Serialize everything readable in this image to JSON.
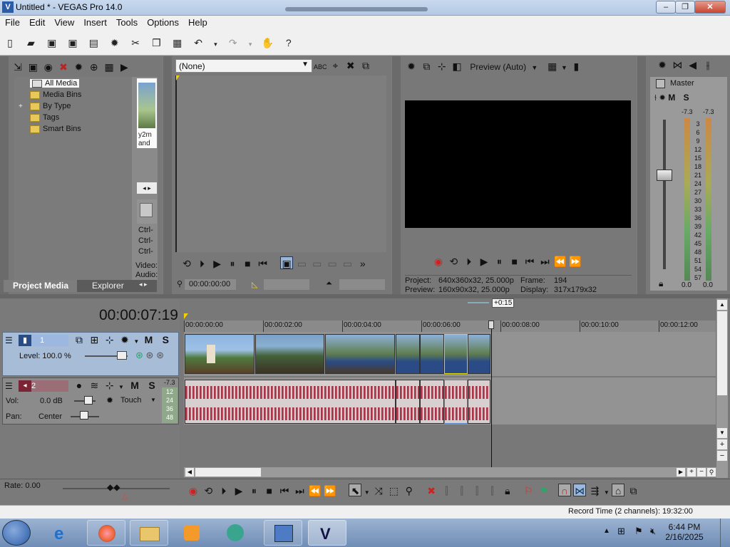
{
  "window": {
    "title": "Untitled * - VEGAS Pro 14.0",
    "minimize": "–",
    "maximize": "❐",
    "close": "✕"
  },
  "menu": [
    "File",
    "Edit",
    "View",
    "Insert",
    "Tools",
    "Options",
    "Help"
  ],
  "project_media": {
    "tree": [
      "All Media",
      "Media Bins",
      "By Type",
      "Tags",
      "Smart Bins"
    ],
    "expand_glyph": "+",
    "thumb_caption": "y2m and",
    "side_labels": [
      "Ctrl-",
      "Ctrl-",
      "Ctrl-"
    ],
    "media_info": [
      "Video:",
      "Audio:"
    ],
    "tabs": [
      "Project Media",
      "Explorer"
    ]
  },
  "trimmer": {
    "selection": "(None)",
    "timecode": "00:00:00:00"
  },
  "preview": {
    "mode": "Preview (Auto)",
    "project_label": "Project:",
    "project_value": "640x360x32, 25.000p",
    "preview_label": "Preview:",
    "preview_value": "160x90x32, 25.000p",
    "frame_label": "Frame:",
    "frame_value": "194",
    "display_label": "Display:",
    "display_value": "317x179x32"
  },
  "master": {
    "title": "Master",
    "m": "M",
    "s": "S",
    "peak_left": "-7.3",
    "peak_right": "-7.3",
    "scale": [
      "3",
      "6",
      "9",
      "12",
      "15",
      "18",
      "21",
      "24",
      "27",
      "30",
      "33",
      "36",
      "39",
      "42",
      "45",
      "48",
      "51",
      "54",
      "57"
    ],
    "bottom_left": "0.0",
    "bottom_right": "0.0"
  },
  "timeline": {
    "current_time": "00:00:07:19",
    "marker_offset": "+0:15",
    "ruler": [
      "00:00:00:00",
      "00:00:02:00",
      "00:00:04:00",
      "00:00:06:00",
      "00:00:08:00",
      "00:00:10:00",
      "00:00:12:00"
    ],
    "rate": "Rate: 0.00"
  },
  "video_track": {
    "number": "1",
    "level": "Level: 100.0 %",
    "m": "M",
    "s": "S"
  },
  "audio_track": {
    "number": "2",
    "m": "M",
    "s": "S",
    "vol_label": "Vol:",
    "vol_value": "0.0 dB",
    "pan_label": "Pan:",
    "pan_value": "Center",
    "mode": "Touch",
    "peak": "-7.3",
    "meter_scale": [
      "12",
      "24",
      "36",
      "48"
    ]
  },
  "status": {
    "record_time": "Record Time (2 channels): 19:32:00"
  },
  "taskbar": {
    "time": "6:44 PM",
    "date": "2/16/2025"
  }
}
